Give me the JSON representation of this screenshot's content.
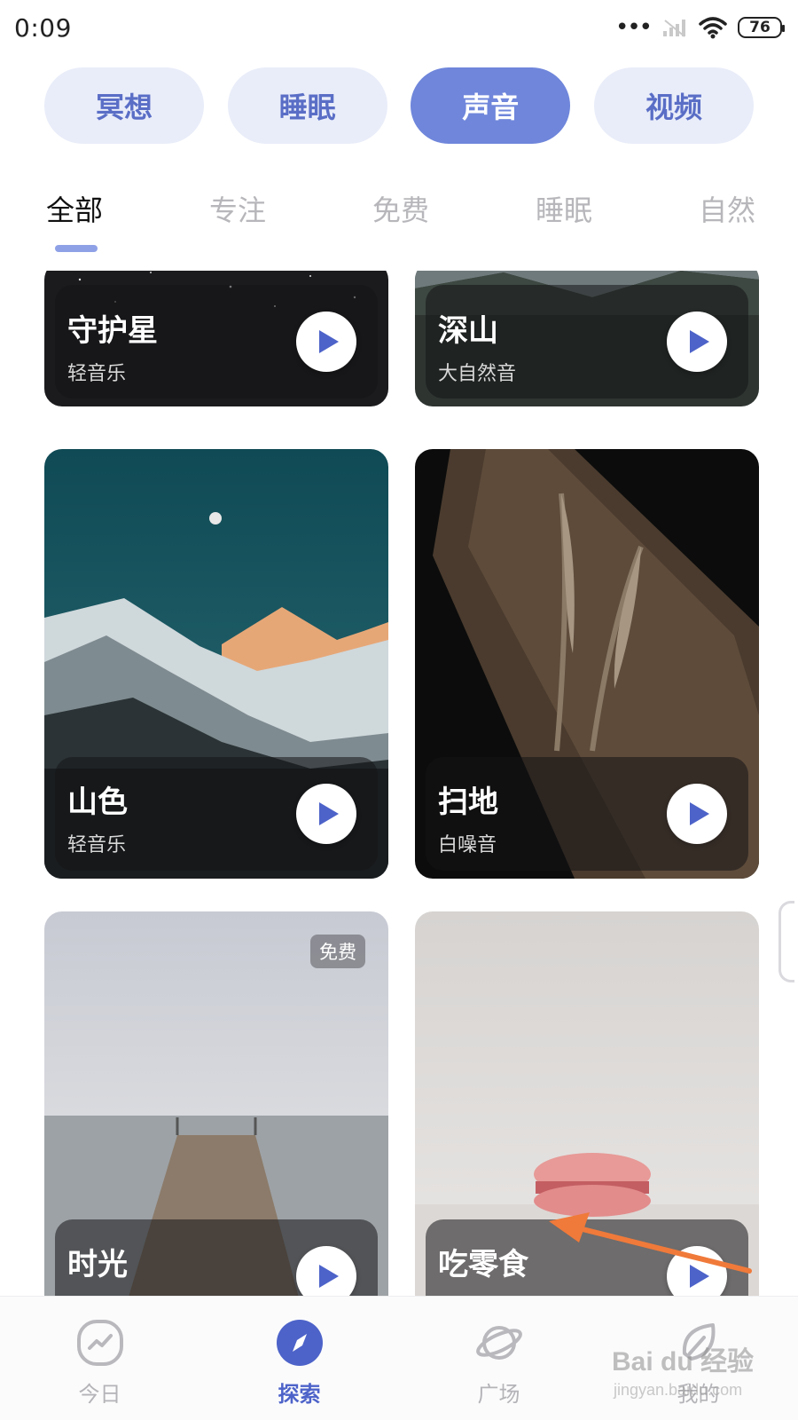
{
  "status_bar": {
    "time": "0:09",
    "dots": "•••",
    "battery": "76"
  },
  "categories": [
    {
      "label": "冥想",
      "active": false
    },
    {
      "label": "睡眠",
      "active": false
    },
    {
      "label": "声音",
      "active": true
    },
    {
      "label": "视频",
      "active": false
    }
  ],
  "filters": [
    {
      "label": "全部",
      "active": true
    },
    {
      "label": "专注",
      "active": false
    },
    {
      "label": "免费",
      "active": false
    },
    {
      "label": "睡眠",
      "active": false
    },
    {
      "label": "自然",
      "active": false
    }
  ],
  "cards": [
    {
      "title": "守护星",
      "subtitle": "轻音乐",
      "art": "starry-night"
    },
    {
      "title": "深山",
      "subtitle": "大自然音",
      "art": "mountain-valley"
    },
    {
      "title": "山色",
      "subtitle": "轻音乐",
      "art": "snowy-mountains-moon"
    },
    {
      "title": "扫地",
      "subtitle": "白噪音",
      "art": "wheat-stalks"
    },
    {
      "title": "时光",
      "subtitle": "",
      "art": "pier-lake",
      "badge": "免费"
    },
    {
      "title": "吃零食",
      "subtitle": "",
      "art": "macaron"
    }
  ],
  "bottom_nav": [
    {
      "label": "今日",
      "icon": "trend-icon",
      "active": false
    },
    {
      "label": "探索",
      "icon": "compass-icon",
      "active": true
    },
    {
      "label": "广场",
      "icon": "planet-icon",
      "active": false
    },
    {
      "label": "我的",
      "icon": "leaf-icon",
      "active": false
    }
  ],
  "watermark": {
    "text": "Bai du 经验",
    "sub": "jingyan.baidu.com"
  },
  "colors": {
    "accent": "#6f86db",
    "pill_bg": "#e9edf9",
    "pill_text": "#5a6ec6",
    "play_icon": "#4d63c9",
    "annotation_arrow": "#f07a3a"
  }
}
